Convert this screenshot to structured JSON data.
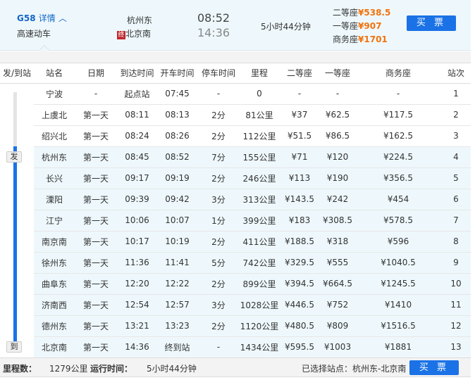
{
  "train": {
    "number": "G58",
    "details_label": "详情",
    "type": "高速动车",
    "from": "杭州东",
    "to": "北京南",
    "end_badge": "终",
    "depart": "08:52",
    "arrive": "14:36",
    "duration": "5小时44分钟",
    "prices": [
      {
        "label": "二等座",
        "value": "¥538.5"
      },
      {
        "label": "一等座",
        "value": "¥907"
      },
      {
        "label": "商务座",
        "value": "¥1701"
      }
    ],
    "buy_label": "买 票"
  },
  "columns": [
    "发/到站",
    "站名",
    "日期",
    "到达时间",
    "开车时间",
    "停车时间",
    "里程",
    "二等座",
    "一等座",
    "商务座",
    "站次"
  ],
  "markers": {
    "depart": "发",
    "arrive": "到"
  },
  "rows": [
    [
      "宁波",
      "-",
      "起点站",
      "07:45",
      "-",
      "0",
      "-",
      "-",
      "-",
      "1"
    ],
    [
      "上虞北",
      "第一天",
      "08:11",
      "08:13",
      "2分",
      "81公里",
      "¥37",
      "¥62.5",
      "¥117.5",
      "2"
    ],
    [
      "绍兴北",
      "第一天",
      "08:24",
      "08:26",
      "2分",
      "112公里",
      "¥51.5",
      "¥86.5",
      "¥162.5",
      "3"
    ],
    [
      "杭州东",
      "第一天",
      "08:45",
      "08:52",
      "7分",
      "155公里",
      "¥71",
      "¥120",
      "¥224.5",
      "4"
    ],
    [
      "长兴",
      "第一天",
      "09:17",
      "09:19",
      "2分",
      "246公里",
      "¥113",
      "¥190",
      "¥356.5",
      "5"
    ],
    [
      "溧阳",
      "第一天",
      "09:39",
      "09:42",
      "3分",
      "313公里",
      "¥143.5",
      "¥242",
      "¥454",
      "6"
    ],
    [
      "江宁",
      "第一天",
      "10:06",
      "10:07",
      "1分",
      "399公里",
      "¥183",
      "¥308.5",
      "¥578.5",
      "7"
    ],
    [
      "南京南",
      "第一天",
      "10:17",
      "10:19",
      "2分",
      "411公里",
      "¥188.5",
      "¥318",
      "¥596",
      "8"
    ],
    [
      "徐州东",
      "第一天",
      "11:36",
      "11:41",
      "5分",
      "742公里",
      "¥329.5",
      "¥555",
      "¥1040.5",
      "9"
    ],
    [
      "曲阜东",
      "第一天",
      "12:20",
      "12:22",
      "2分",
      "899公里",
      "¥394.5",
      "¥664.5",
      "¥1245.5",
      "10"
    ],
    [
      "济南西",
      "第一天",
      "12:54",
      "12:57",
      "3分",
      "1028公里",
      "¥446.5",
      "¥752",
      "¥1410",
      "11"
    ],
    [
      "德州东",
      "第一天",
      "13:21",
      "13:23",
      "2分",
      "1120公里",
      "¥480.5",
      "¥809",
      "¥1516.5",
      "12"
    ],
    [
      "北京南",
      "第一天",
      "14:36",
      "终到站",
      "-",
      "1434公里",
      "¥595.5",
      "¥1003",
      "¥1881",
      "13"
    ]
  ],
  "footer": {
    "distance_label": "里程数：",
    "distance": "1279公里",
    "runtime_label": "运行时间：",
    "runtime": "5小时44分钟",
    "selected": "已选择站点：杭州东-北京南",
    "buy_label": "买 票"
  },
  "colors": {
    "accent": "#1a72e6",
    "price": "#f2720c",
    "selected_row": "#eef8fc"
  }
}
